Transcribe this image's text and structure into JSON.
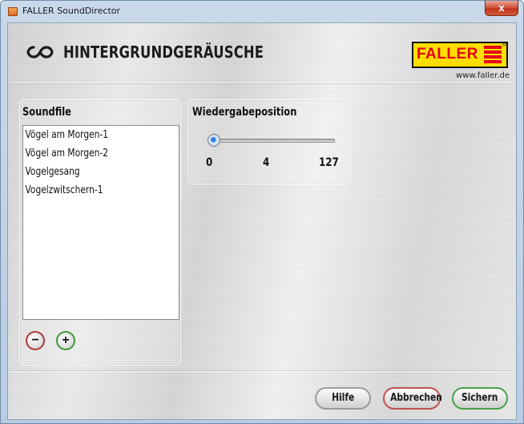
{
  "window": {
    "title": "FALLER SoundDirector",
    "close_label": "x"
  },
  "header": {
    "title": "HINTERGRUNDGERÄUSCHE",
    "icon": "loop-icon",
    "logo_text": "FALLER",
    "logo_reg": "®",
    "website": "www.faller.de"
  },
  "soundfile": {
    "label": "Soundfile",
    "items": [
      "Vögel am Morgen-1",
      "Vögel am Morgen-2",
      "Vogelgesang",
      "Vogelzwitschern-1"
    ],
    "remove_label": "−",
    "add_label": "+"
  },
  "playback": {
    "label": "Wiedergabeposition",
    "min": "0",
    "value": "4",
    "max": "127",
    "level": 0.0315
  },
  "buttons": {
    "help": "Hilfe",
    "cancel": "Abbrechen",
    "save": "Sichern"
  },
  "colors": {
    "logo_yellow": "#ffdd00",
    "logo_red": "#e2001a",
    "remove_ring": "#b23a3a",
    "add_ring": "#3e9a3a",
    "cancel_ring": "#c05050",
    "save_ring": "#4aa04a"
  }
}
